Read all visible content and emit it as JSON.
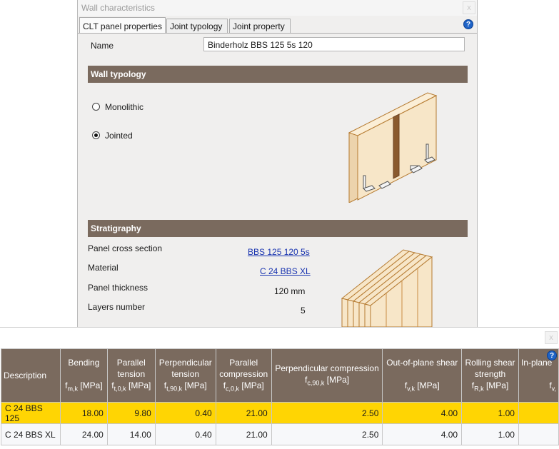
{
  "dialog": {
    "title": "Wall characteristics",
    "close_label": "x",
    "tabs": [
      {
        "label": "CLT panel properties",
        "active": true
      },
      {
        "label": "Joint typology",
        "active": false
      },
      {
        "label": "Joint property",
        "active": false
      }
    ],
    "help_label": "?",
    "name_label": "Name",
    "name_value": "Binderholz BBS 125 5s 120",
    "wall_typology": {
      "title": "Wall typology",
      "options": [
        {
          "label": "Monolithic",
          "selected": false
        },
        {
          "label": "Jointed",
          "selected": true
        }
      ]
    },
    "stratigraphy": {
      "title": "Stratigraphy",
      "rows": [
        {
          "label": "Panel cross section",
          "value": "BBS 125 120 5s",
          "link": true
        },
        {
          "label": "Material",
          "value": "C 24 BBS XL",
          "link": true
        },
        {
          "label": "Panel thickness",
          "value": "120 mm",
          "link": false
        },
        {
          "label": "Layers number",
          "value": "5",
          "link": false
        }
      ]
    }
  },
  "table": {
    "close_label": "x",
    "help_label": "?",
    "columns": [
      {
        "title": "Description",
        "symbol": "f",
        "sub": "",
        "unit": ""
      },
      {
        "title": "Bending",
        "symbol": "f",
        "sub": "m,k",
        "unit": "[MPa]"
      },
      {
        "title": "Parallel tension",
        "symbol": "f",
        "sub": "t,0,k",
        "unit": "[MPa]"
      },
      {
        "title": "Perpendicular tension",
        "symbol": "f",
        "sub": "t,90,k",
        "unit": "[MPa]"
      },
      {
        "title": "Parallel compression",
        "symbol": "f",
        "sub": "c,0,k",
        "unit": "[MPa]"
      },
      {
        "title": "Perpendicular compression",
        "symbol": "f",
        "sub": "c,90,k",
        "unit": "[MPa]"
      },
      {
        "title": "Out-of-plane shear",
        "symbol": "f",
        "sub": "v,k",
        "unit": "[MPa]"
      },
      {
        "title": "Rolling shear strength",
        "symbol": "f",
        "sub": "R,k",
        "unit": "[MPa]"
      },
      {
        "title": "In-plane",
        "symbol": "f",
        "sub": "v,",
        "unit": ""
      }
    ],
    "rows": [
      {
        "selected": true,
        "cells": [
          "C 24 BBS 125",
          "18.00",
          "9.80",
          "0.40",
          "21.00",
          "2.50",
          "4.00",
          "1.00",
          ""
        ]
      },
      {
        "selected": false,
        "cells": [
          "C 24 BBS XL",
          "24.00",
          "14.00",
          "0.40",
          "21.00",
          "2.50",
          "4.00",
          "1.00",
          ""
        ]
      }
    ]
  },
  "colors": {
    "section_header": "#7a6a5e",
    "selected_row": "#ffd503",
    "link": "#1a35b0",
    "help_icon": "#1e63c7",
    "wood": "#f7e6c8",
    "wood_outline": "#b57a30"
  }
}
